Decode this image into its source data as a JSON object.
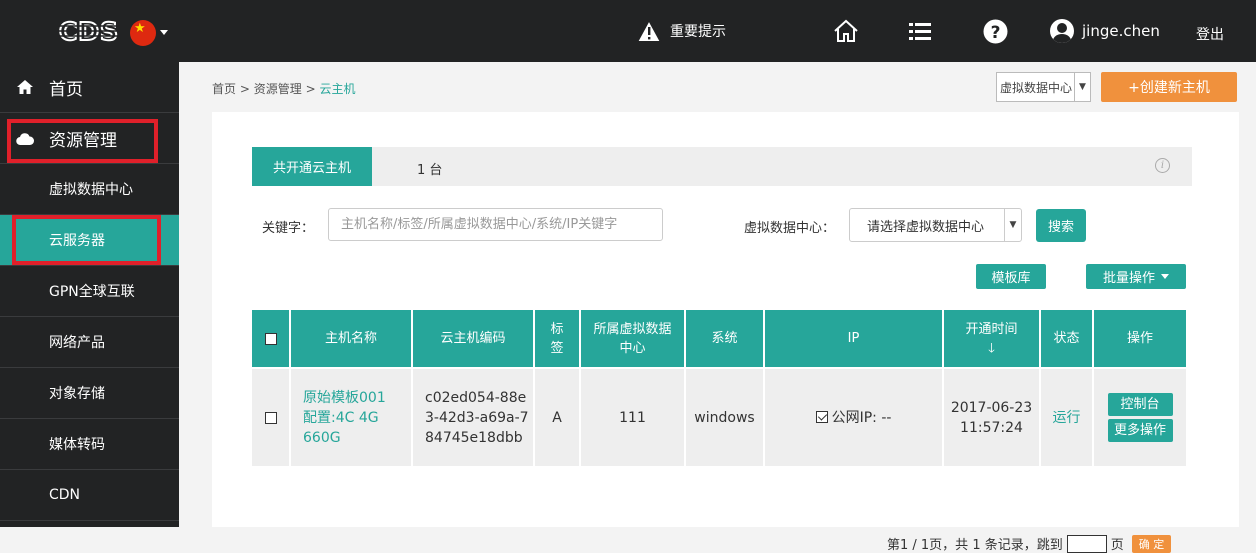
{
  "topbar": {
    "logo_text": "CDS",
    "notice": "重要提示",
    "icons": [
      "home-icon",
      "list-icon",
      "help-icon"
    ],
    "username": "jinge.chen",
    "logout": "登出"
  },
  "sidebar": {
    "items": [
      {
        "label": "首页",
        "icon": "home-icon"
      },
      {
        "label": "资源管理",
        "icon": "cloud-icon"
      },
      {
        "label": "虚拟数据中心"
      },
      {
        "label": "云服务器",
        "active": true
      },
      {
        "label": "GPN全球互联"
      },
      {
        "label": "网络产品"
      },
      {
        "label": "对象存储"
      },
      {
        "label": "媒体转码"
      },
      {
        "label": "CDN"
      }
    ]
  },
  "breadcrumb": {
    "home": "首页",
    "sep": ">",
    "section": "资源管理",
    "current": "云主机"
  },
  "header": {
    "dc_select": "虚拟数据中心",
    "create_button": "+创建新主机"
  },
  "tabs": {
    "active": "共开通云主机",
    "count": "1 台"
  },
  "filter": {
    "keyword_label": "关键字：",
    "keyword_placeholder": "主机名称/标签/所属虚拟数据中心/系统/IP关键字",
    "dc_label": "虚拟数据中心：",
    "dc_value": "请选择虚拟数据中心",
    "search_button": "搜索"
  },
  "actions": {
    "template_button": "模板库",
    "batch_button": "批量操作"
  },
  "table": {
    "headers": [
      "主机名称",
      "云主机编码",
      "标签",
      "所属虚拟数据中心",
      "系统",
      "IP",
      "开通时间",
      "状态",
      "操作"
    ],
    "rows": [
      {
        "name": "原始模板001",
        "config": "配置:4C 4G 660G",
        "code": "c02ed054-88e3-42d3-a69a-784745e18dbb",
        "tag": "A",
        "dc": "111",
        "os": "windows",
        "ip": "公网IP: --",
        "time": "2017-06-23 11:57:24",
        "status": "运行",
        "op_console": "控制台",
        "op_more": "更多操作"
      }
    ]
  },
  "pager": {
    "text": "第1 / 1页，共 1 条记录，跳到",
    "page_unit": "页",
    "ok": "确 定"
  },
  "colors": {
    "accent": "#26a69a",
    "orange": "#f0913d",
    "dark": "#222324",
    "highlight": "#e0202a"
  }
}
